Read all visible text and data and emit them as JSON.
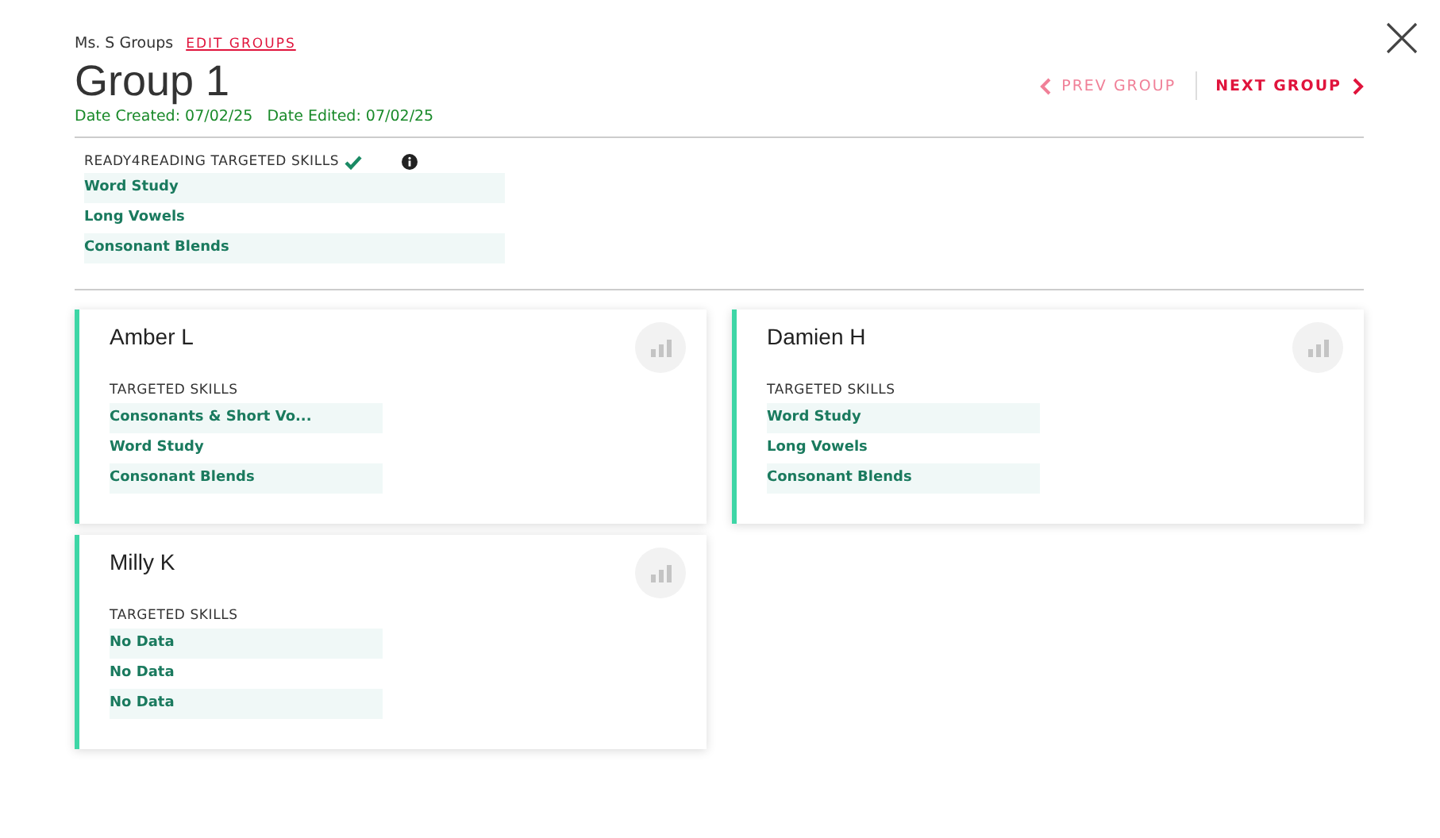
{
  "breadcrumb": {
    "owner": "Ms. S Groups",
    "edit_link": "EDIT GROUPS"
  },
  "title": "Group 1",
  "dates": [
    "Date Created: 07/02/25",
    "Date Edited: 07/02/25"
  ],
  "nav": [
    {
      "kind": "prev",
      "label": "PREV GROUP",
      "disabled": true
    },
    {
      "kind": "next",
      "label": "NEXT GROUP",
      "disabled": false
    }
  ],
  "group_skills": {
    "heading": "READY4READING TARGETED SKILLS",
    "items": [
      "Word Study",
      "Long Vowels",
      "Consonant Blends"
    ]
  },
  "students": [
    {
      "name": "Amber L",
      "skills_heading": "TARGETED SKILLS",
      "skills": [
        "Consonants & Short Vo...",
        "Word Study",
        "Consonant Blends"
      ]
    },
    {
      "name": "Damien H",
      "skills_heading": "TARGETED SKILLS",
      "skills": [
        "Word Study",
        "Long Vowels",
        "Consonant Blends"
      ]
    },
    {
      "name": "Milly K",
      "skills_heading": "TARGETED SKILLS",
      "skills": [
        "No Data",
        "No Data",
        "No Data"
      ]
    }
  ]
}
